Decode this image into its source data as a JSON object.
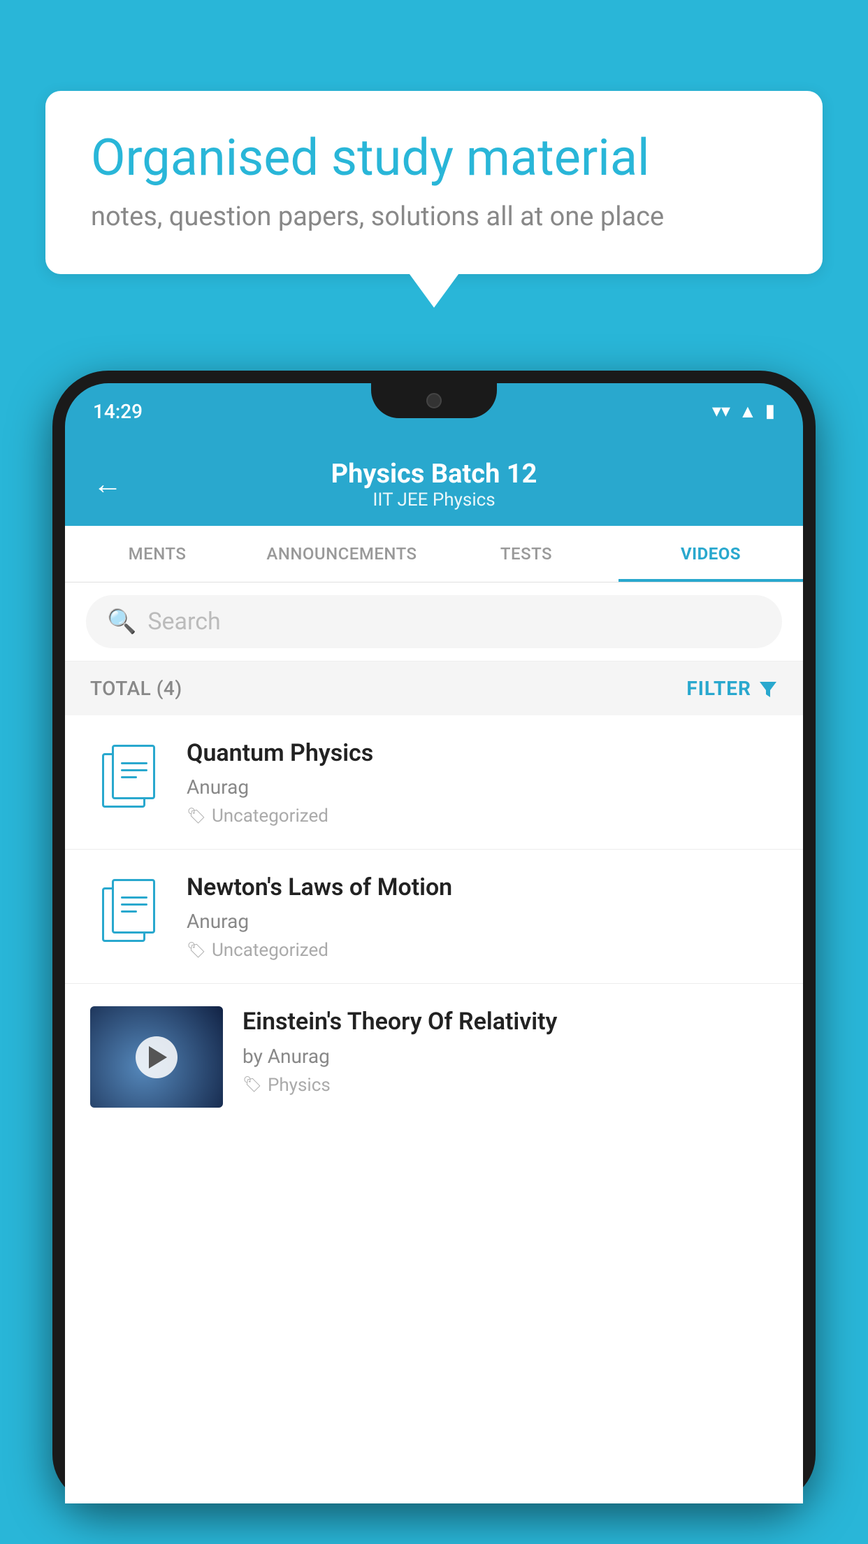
{
  "background_color": "#29b6d8",
  "speech_bubble": {
    "heading": "Organised study material",
    "subtext": "notes, question papers, solutions all at one place"
  },
  "phone": {
    "status_bar": {
      "time": "14:29",
      "icons": [
        "wifi",
        "signal",
        "battery"
      ]
    },
    "header": {
      "back_label": "←",
      "title": "Physics Batch 12",
      "subtitle": "IIT JEE   Physics"
    },
    "tabs": [
      {
        "label": "MENTS",
        "active": false
      },
      {
        "label": "ANNOUNCEMENTS",
        "active": false
      },
      {
        "label": "TESTS",
        "active": false
      },
      {
        "label": "VIDEOS",
        "active": true
      }
    ],
    "search": {
      "placeholder": "Search"
    },
    "filter_bar": {
      "total_label": "TOTAL (4)",
      "filter_label": "FILTER"
    },
    "videos": [
      {
        "id": 1,
        "title": "Quantum Physics",
        "author": "Anurag",
        "tag": "Uncategorized",
        "type": "doc",
        "has_thumbnail": false
      },
      {
        "id": 2,
        "title": "Newton's Laws of Motion",
        "author": "Anurag",
        "tag": "Uncategorized",
        "type": "doc",
        "has_thumbnail": false
      },
      {
        "id": 3,
        "title": "Einstein's Theory Of Relativity",
        "author": "by Anurag",
        "tag": "Physics",
        "type": "video",
        "has_thumbnail": true
      }
    ]
  }
}
